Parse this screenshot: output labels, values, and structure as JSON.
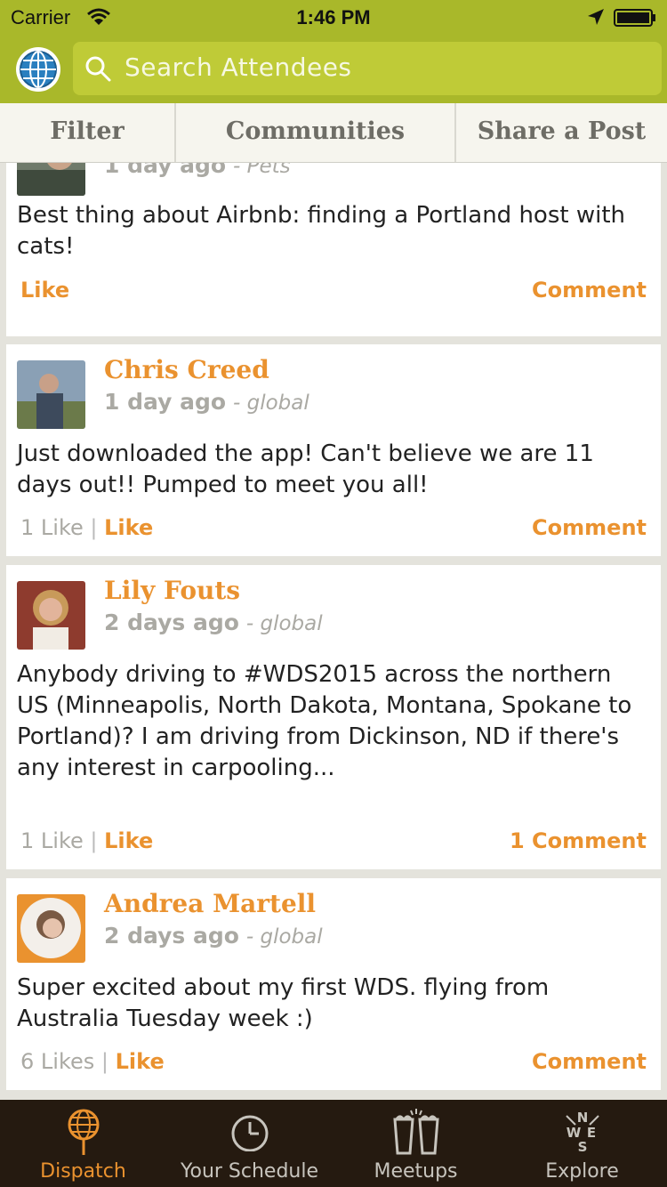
{
  "status_bar": {
    "carrier": "Carrier",
    "time": "1:46 PM"
  },
  "search": {
    "placeholder": "Search Attendees"
  },
  "tabs": [
    {
      "label": "Filter"
    },
    {
      "label": "Communities"
    },
    {
      "label": "Share a Post"
    }
  ],
  "posts": [
    {
      "name": "",
      "ago": "1 day ago",
      "community": "Pets",
      "body": "Best thing about Airbnb: finding a Portland host with cats!",
      "likes": "",
      "like_label": "Like",
      "comment_label": "Comment"
    },
    {
      "name": "Chris Creed",
      "ago": "1 day ago",
      "community": "global",
      "body": "Just downloaded the app! Can't believe we are 11 days out!! Pumped to meet you all!",
      "likes": "1 Like",
      "like_label": "Like",
      "comment_label": "Comment"
    },
    {
      "name": "Lily Fouts",
      "ago": "2 days ago",
      "community": "global",
      "body": "Anybody driving to #WDS2015 across the northern US (Minneapolis, North Dakota, Montana, Spokane to Portland)?  I am driving from Dickinson, ND if there's any interest in carpooling...",
      "likes": "1 Like",
      "like_label": "Like",
      "comment_label": "1 Comment"
    },
    {
      "name": "Andrea Martell",
      "ago": "2 days ago",
      "community": "global",
      "body": "Super excited about my first WDS. flying from Australia Tuesday week :)",
      "likes": "6 Likes",
      "like_label": "Like",
      "comment_label": "Comment"
    }
  ],
  "tabbar": [
    {
      "label": "Dispatch",
      "icon": "globe-icon",
      "active": true
    },
    {
      "label": "Your Schedule",
      "icon": "clock-icon"
    },
    {
      "label": "Meetups",
      "icon": "beer-glasses-icon"
    },
    {
      "label": "Explore",
      "icon": "compass-icon"
    }
  ],
  "colors": {
    "header": "#a9b82a",
    "accent": "#ea922f",
    "tabbar": "#251a10"
  }
}
